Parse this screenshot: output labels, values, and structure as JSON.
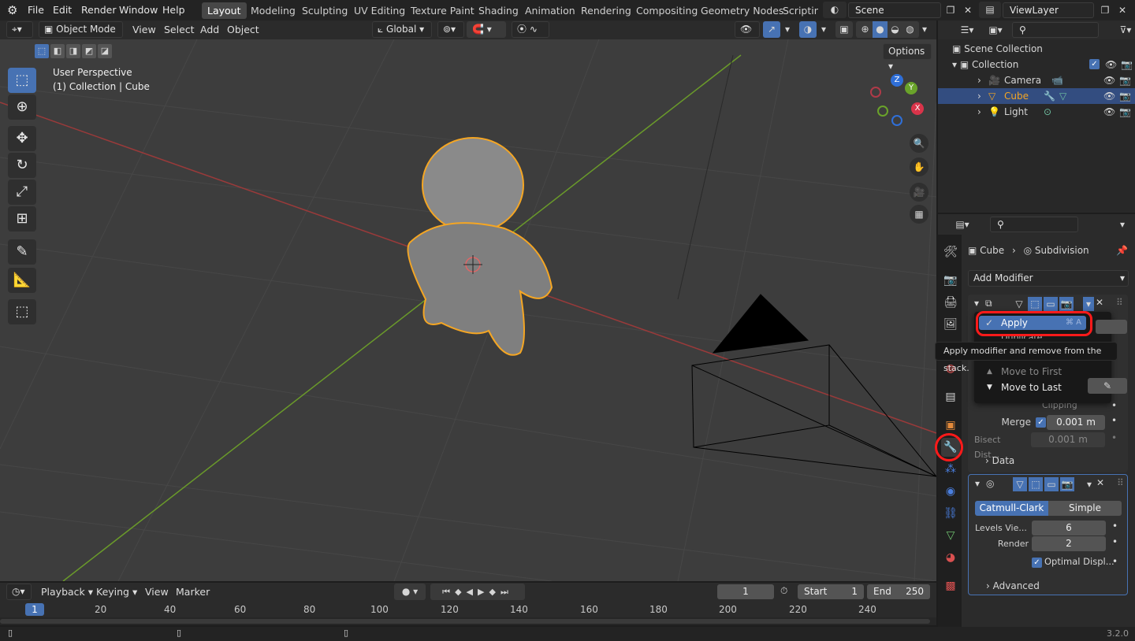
{
  "app": {
    "version": "3.2.0"
  },
  "menu": [
    "File",
    "Edit",
    "Render",
    "Window",
    "Help"
  ],
  "workspaces": [
    "Layout",
    "Modeling",
    "Sculpting",
    "UV Editing",
    "Texture Paint",
    "Shading",
    "Animation",
    "Rendering",
    "Compositing",
    "Geometry Nodes",
    "Scripting"
  ],
  "scene": {
    "name": "Scene"
  },
  "view_layer": {
    "name": "ViewLayer"
  },
  "viewport_header": {
    "mode": "Object Mode",
    "menus": [
      "View",
      "Select",
      "Add",
      "Object"
    ],
    "orientation": "Global",
    "options_label": "Options"
  },
  "viewport": {
    "perspective": "User Perspective",
    "context": "(1) Collection | Cube",
    "gizmo_axes": [
      "Z",
      "Y",
      "X"
    ]
  },
  "outliner": {
    "root": "Scene Collection",
    "collection": "Collection",
    "items": [
      {
        "name": "Camera",
        "selected": false
      },
      {
        "name": "Cube",
        "selected": true
      },
      {
        "name": "Light",
        "selected": false
      }
    ]
  },
  "properties": {
    "breadcrumb_object": "Cube",
    "breadcrumb_modifier": "Subdivision",
    "add_modifier": "Add Modifier",
    "mirror": {
      "merge_label": "Merge",
      "merge_value": "0.001 m",
      "bisect_label": "Bisect Dist...",
      "bisect_value": "0.001 m",
      "clipping_label": "Clipping",
      "data_label": "Data"
    },
    "subdivision": {
      "methods": [
        "Catmull-Clark",
        "Simple"
      ],
      "levels_label": "Levels Vie...",
      "levels_value": "6",
      "render_label": "Render",
      "render_value": "2",
      "optimal_label": "Optimal Displ...",
      "advanced_label": "Advanced"
    }
  },
  "context_menu": {
    "apply": "Apply",
    "apply_shortcut": "⌘ A",
    "duplicate": "Duplicate",
    "move_first": "Move to First",
    "move_last": "Move to Last",
    "tooltip": "Apply modifier and remove from the stack."
  },
  "timeline": {
    "menus": [
      "Playback",
      "Keying",
      "View",
      "Marker"
    ],
    "current_frame": "1",
    "start_label": "Start",
    "start_value": "1",
    "end_label": "End",
    "end_value": "250",
    "ruler": [
      "20",
      "40",
      "60",
      "80",
      "100",
      "120",
      "140",
      "160",
      "180",
      "200",
      "220",
      "240"
    ],
    "playhead": "1"
  },
  "colors": {
    "accent": "#4772b3",
    "highlight_ring": "#ff1a1a",
    "selection": "#f5a623"
  }
}
